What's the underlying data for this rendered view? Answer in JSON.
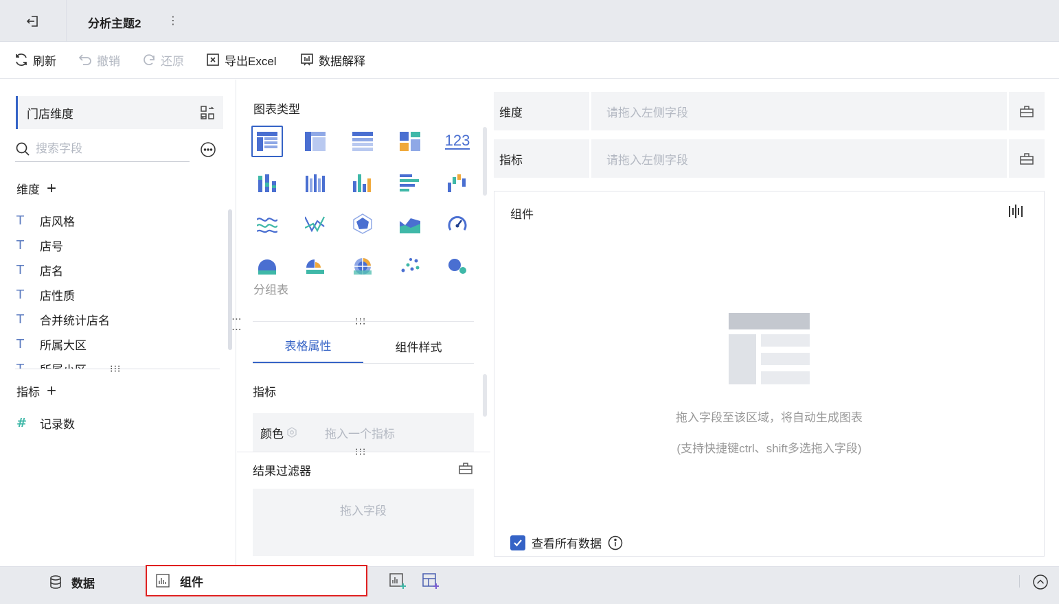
{
  "header": {
    "tab_title": "分析主题2",
    "tab_more": "⋮"
  },
  "toolbar": {
    "refresh": "刷新",
    "undo": "撤销",
    "redo": "还原",
    "export_excel": "导出Excel",
    "data_explain": "数据解释"
  },
  "left_panel": {
    "table_name": "门店维度",
    "search_placeholder": "搜索字段",
    "dimension_label": "维度",
    "dimensions": [
      "店风格",
      "店号",
      "店名",
      "店性质",
      "合并统计店名",
      "所属大区",
      "所属小区"
    ],
    "dimension_type_glyph": "T",
    "metric_label": "指标",
    "metrics": [
      "记录数"
    ],
    "metric_type_glyph": "#"
  },
  "chart_panel": {
    "title": "图表类型",
    "selected_chart_name": "分组表",
    "chart_types": [
      {
        "name": "grouped-table",
        "selected": true
      },
      {
        "name": "cross-table"
      },
      {
        "name": "detail-table"
      },
      {
        "name": "kpi-card"
      },
      {
        "name": "number-text",
        "text": "123"
      },
      {
        "name": "stacked-bar"
      },
      {
        "name": "multi-bar"
      },
      {
        "name": "column-chart"
      },
      {
        "name": "horizontal-bar"
      },
      {
        "name": "waterfall"
      },
      {
        "name": "line-chart"
      },
      {
        "name": "combo-line"
      },
      {
        "name": "radar-chart"
      },
      {
        "name": "area-chart"
      },
      {
        "name": "gauge"
      },
      {
        "name": "pie-chart"
      },
      {
        "name": "rose-chart"
      },
      {
        "name": "sunburst"
      },
      {
        "name": "scatter"
      },
      {
        "name": "bubble"
      }
    ],
    "tabs": [
      "表格属性",
      "组件样式"
    ],
    "active_tab": "表格属性",
    "metric_section": "指标",
    "color_label": "颜色",
    "color_placeholder": "拖入一个指标",
    "filter_label": "结果过滤器",
    "filter_placeholder": "拖入字段"
  },
  "drop_zones": {
    "dimension_label": "维度",
    "dimension_placeholder": "请拖入左侧字段",
    "metric_label": "指标",
    "metric_placeholder": "请拖入左侧字段"
  },
  "canvas": {
    "title": "组件",
    "hint1": "拖入字段至该区域，将自动生成图表",
    "hint2": "(支持快捷键ctrl、shift多选拖入字段)",
    "view_all_label": "查看所有数据",
    "view_all_checked": true
  },
  "bottom": {
    "data_tab": "数据",
    "component_tab": "组件"
  },
  "colors": {
    "accent": "#3563c6",
    "chart_blue": "#4a6fd1",
    "chart_teal": "#3fb8a8",
    "chart_orange": "#f0a93b",
    "highlight_border": "#e02020"
  }
}
